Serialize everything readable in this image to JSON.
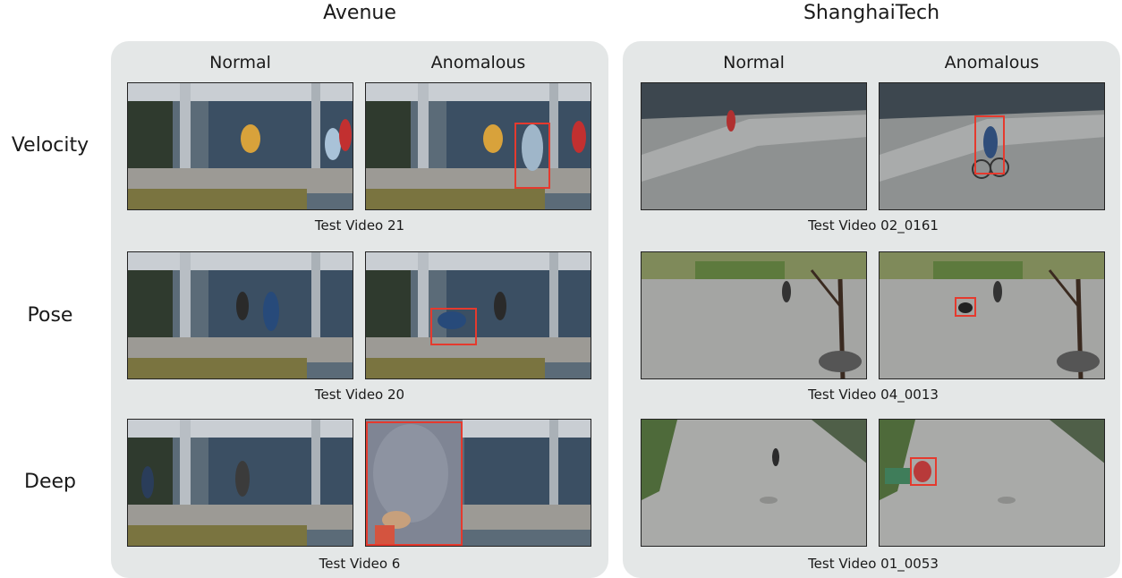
{
  "datasets": [
    {
      "title": "Avenue",
      "col_normal": "Normal",
      "col_anomalous": "Anomalous",
      "rows": [
        {
          "caption": "Test Video 21"
        },
        {
          "caption": "Test Video 20"
        },
        {
          "caption": "Test Video 6"
        }
      ]
    },
    {
      "title": "ShanghaiTech",
      "col_normal": "Normal",
      "col_anomalous": "Anomalous",
      "rows": [
        {
          "caption": "Test Video 02_0161"
        },
        {
          "caption": "Test Video 04_0013"
        },
        {
          "caption": "Test Video 01_0053"
        }
      ]
    }
  ],
  "row_labels": [
    "Velocity",
    "Pose",
    "Deep"
  ],
  "colors": {
    "panel_bg": "#e4e7e7",
    "bbox": "#e53a2e"
  }
}
